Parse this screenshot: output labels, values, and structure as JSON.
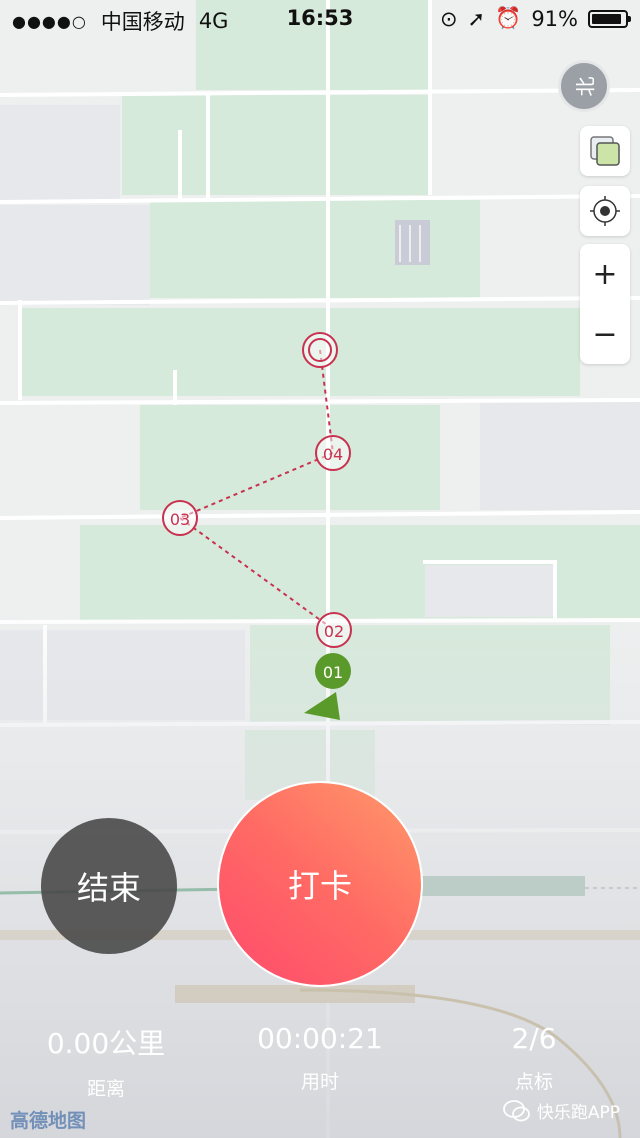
{
  "status_bar": {
    "signal_dots": "●●●●○",
    "carrier": "中国移动",
    "network": "4G",
    "time": "16:53",
    "battery_percent": "91%",
    "battery_level": 0.91
  },
  "map": {
    "compass_label": "北",
    "zoom_in": "+",
    "zoom_out": "−",
    "markers": [
      "01",
      "02",
      "03",
      "04",
      ""
    ],
    "logo": "高德地图"
  },
  "actions": {
    "end_label": "结束",
    "checkin_label": "打卡"
  },
  "stats": {
    "distance_value": "0.00公里",
    "distance_label": "距离",
    "time_value": "00:00:21",
    "time_label": "用时",
    "points_value": "2/6",
    "points_label": "点标"
  },
  "watermark": "快乐跑APP",
  "colors": {
    "marker_red": "#c8314f",
    "marker_green": "#5a9a2a",
    "checkin_gradient": [
      "#ff4a6d",
      "#ff9a6a"
    ]
  }
}
